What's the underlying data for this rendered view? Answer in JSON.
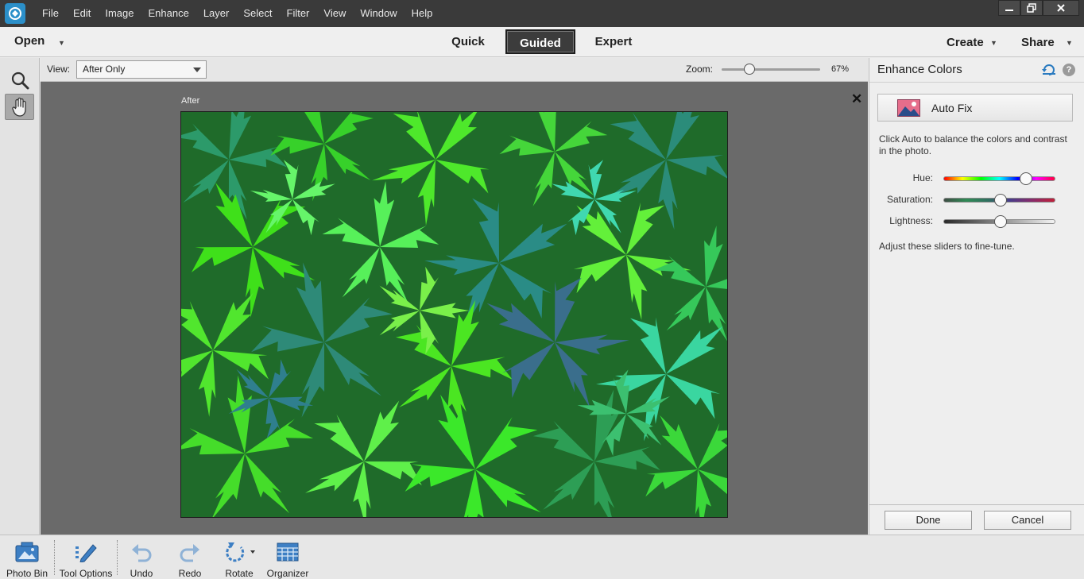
{
  "menubar": {
    "items": [
      "File",
      "Edit",
      "Image",
      "Enhance",
      "Layer",
      "Select",
      "Filter",
      "View",
      "Window",
      "Help"
    ]
  },
  "modebar": {
    "open_label": "Open",
    "tabs": [
      "Quick",
      "Guided",
      "Expert"
    ],
    "active_tab": "Guided",
    "create_label": "Create",
    "share_label": "Share"
  },
  "tools": [
    "zoom-tool",
    "hand-tool"
  ],
  "viewbar": {
    "view_label": "View:",
    "view_value": "After Only",
    "zoom_label": "Zoom:",
    "zoom_value": "67%",
    "zoom_level": 0.25
  },
  "canvas": {
    "after_label": "After",
    "close_glyph": "✕"
  },
  "panel": {
    "title": "Enhance Colors",
    "autofix_label": "Auto Fix",
    "description": "Click Auto to balance the colors and contrast in the photo.",
    "sliders": [
      {
        "label": "Hue:",
        "value": 0.76
      },
      {
        "label": "Saturation:",
        "value": 0.5
      },
      {
        "label": "Lightness:",
        "value": 0.5
      }
    ],
    "fine_tune": "Adjust these sliders to fine-tune.",
    "done_label": "Done",
    "cancel_label": "Cancel"
  },
  "bottombar": {
    "photo_bin": "Photo Bin",
    "tool_options": "Tool Options",
    "undo": "Undo",
    "redo": "Redo",
    "rotate": "Rotate",
    "organizer": "Organizer"
  },
  "colors": {
    "menubar_bg": "#3a3a3a",
    "canvas_bg": "#6a6a6a",
    "active_tab_bg": "#3c3c3c",
    "accent_blue": "#2b7bc0",
    "leaf_green": "#3fe01a",
    "leaf_teal": "#2a8c86"
  }
}
